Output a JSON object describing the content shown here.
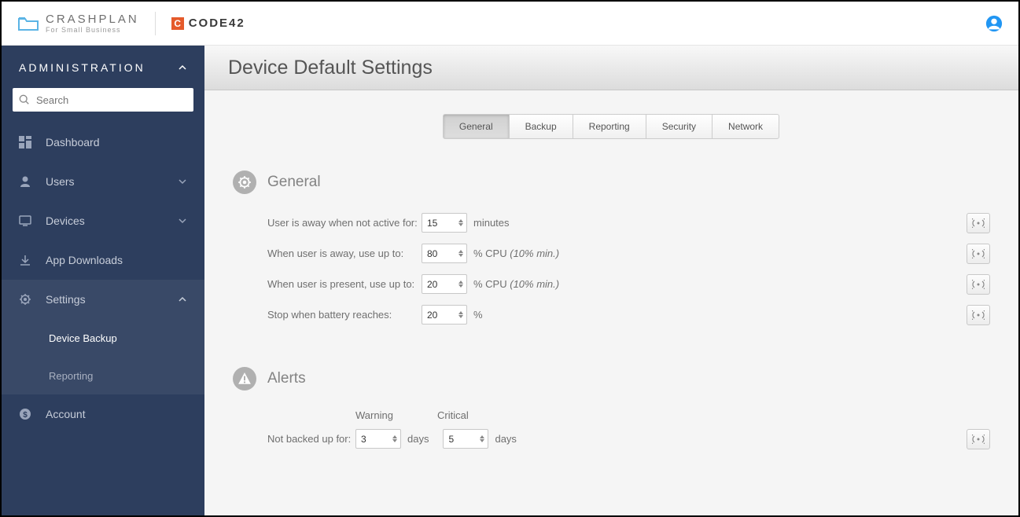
{
  "brand": {
    "crashplan": "CRASHPLAN",
    "crashplan_tag": "For Small Business",
    "code42": "CODE42"
  },
  "sidebar": {
    "section": "ADMINISTRATION",
    "search_placeholder": "Search",
    "items": {
      "dashboard": "Dashboard",
      "users": "Users",
      "devices": "Devices",
      "app_downloads": "App Downloads",
      "settings": "Settings",
      "account": "Account"
    },
    "settings_sub": {
      "device_backup": "Device Backup",
      "reporting": "Reporting"
    }
  },
  "page": {
    "title": "Device Default Settings"
  },
  "tabs": {
    "general": "General",
    "backup": "Backup",
    "reporting": "Reporting",
    "security": "Security",
    "network": "Network"
  },
  "general": {
    "title": "General",
    "rows": {
      "away_label": "User is away when not active for:",
      "away_value": "15",
      "away_units": "minutes",
      "cpu_away_label": "When user is away, use up to:",
      "cpu_away_value": "80",
      "cpu_away_units": "% CPU",
      "cpu_away_hint": "(10% min.)",
      "cpu_present_label": "When user is present, use up to:",
      "cpu_present_value": "20",
      "cpu_present_units": "% CPU",
      "cpu_present_hint": "(10% min.)",
      "battery_label": "Stop when battery reaches:",
      "battery_value": "20",
      "battery_units": "%"
    }
  },
  "alerts": {
    "title": "Alerts",
    "warning_col": "Warning",
    "critical_col": "Critical",
    "not_backed_label": "Not backed up for:",
    "warn_value": "3",
    "warn_units": "days",
    "crit_value": "5",
    "crit_units": "days"
  }
}
